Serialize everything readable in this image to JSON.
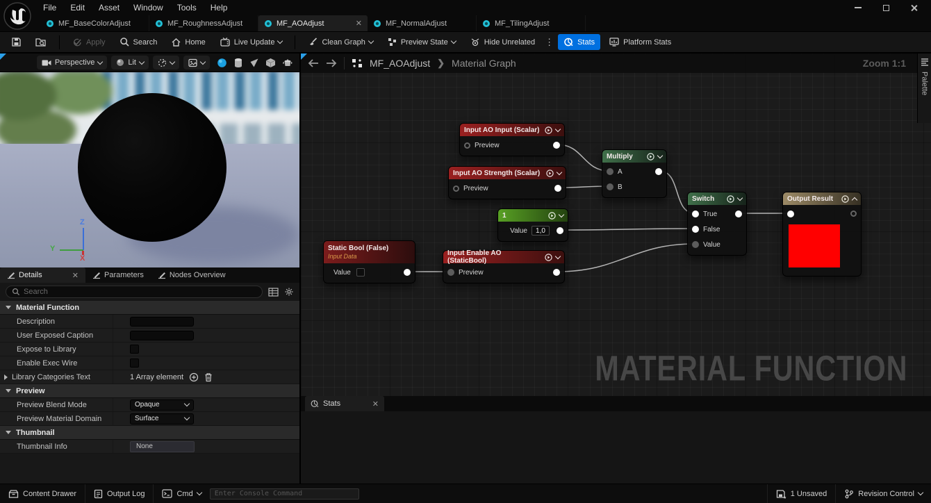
{
  "colors": {
    "accent_blue": "#0070e0",
    "node_input_red": "#9a2020",
    "node_math_green": "#40704a",
    "node_const_green": "#58a024",
    "node_output_tan": "#9c8a66",
    "preview_red": "#ff0000",
    "doc_tab_icon_teal": "#22c0d6",
    "corner_highlight_blue": "#2b9fe8"
  },
  "titlebar": {
    "menus": [
      "File",
      "Edit",
      "Asset",
      "Window",
      "Tools",
      "Help"
    ]
  },
  "doc_tabs": [
    {
      "label": "MF_BaseColorAdjust",
      "active": false
    },
    {
      "label": "MF_RoughnessAdjust",
      "active": false
    },
    {
      "label": "MF_AOAdjust",
      "active": true
    },
    {
      "label": "MF_NormalAdjust",
      "active": false
    },
    {
      "label": "MF_TilingAdjust",
      "active": false
    }
  ],
  "toolbar": {
    "apply": "Apply",
    "search": "Search",
    "home": "Home",
    "live_update": "Live Update",
    "clean_graph": "Clean Graph",
    "preview_state": "Preview State",
    "hide_unrelated": "Hide Unrelated",
    "stats": "Stats",
    "platform_stats": "Platform Stats"
  },
  "viewport": {
    "perspective_label": "Perspective",
    "lit_label": "Lit",
    "axis_x": "X",
    "axis_y": "Y",
    "axis_z": "Z"
  },
  "graph": {
    "breadcrumb_asset": "MF_AOAdjust",
    "breadcrumb_section": "Material Graph",
    "zoom_label": "Zoom 1:1",
    "palette_label": "Palette",
    "watermark": "MATERIAL FUNCTION",
    "stats_tab": "Stats",
    "nodes": {
      "input_ao_input": {
        "title": "Input AO Input (Scalar)",
        "pin_preview": "Preview"
      },
      "input_ao_strength": {
        "title": "Input AO Strength (Scalar)",
        "pin_preview": "Preview"
      },
      "multiply": {
        "title": "Multiply",
        "pin_a": "A",
        "pin_b": "B"
      },
      "const_one": {
        "title": "1",
        "value_label": "Value",
        "value": "1,0"
      },
      "switch_node": {
        "title": "Switch",
        "pin_true": "True",
        "pin_false": "False",
        "pin_value": "Value"
      },
      "output_result": {
        "title": "Output Result"
      },
      "static_bool": {
        "title": "Static Bool (False)",
        "subtitle": "Input Data",
        "value_label": "Value"
      },
      "input_enable_ao": {
        "title": "Input Enable AO (StaticBool)",
        "pin_preview": "Preview"
      }
    }
  },
  "details": {
    "tabs": [
      "Details",
      "Parameters",
      "Nodes Overview"
    ],
    "search_placeholder": "Search",
    "material_function": {
      "header": "Material Function",
      "description": "Description",
      "user_exposed_caption": "User Exposed Caption",
      "expose_to_library": "Expose to Library",
      "enable_exec_wire": "Enable Exec Wire",
      "library_categories": "Library Categories Text",
      "library_categories_value": "1 Array element"
    },
    "preview": {
      "header": "Preview",
      "blend_mode_label": "Preview Blend Mode",
      "blend_mode_value": "Opaque",
      "material_domain_label": "Preview Material Domain",
      "material_domain_value": "Surface"
    },
    "thumbnail": {
      "header": "Thumbnail",
      "info_label": "Thumbnail Info",
      "info_value": "None"
    }
  },
  "statusbar": {
    "content_drawer": "Content Drawer",
    "output_log": "Output Log",
    "cmd": "Cmd",
    "console_placeholder": "Enter Console Command",
    "unsaved": "1 Unsaved",
    "revision_control": "Revision Control"
  }
}
